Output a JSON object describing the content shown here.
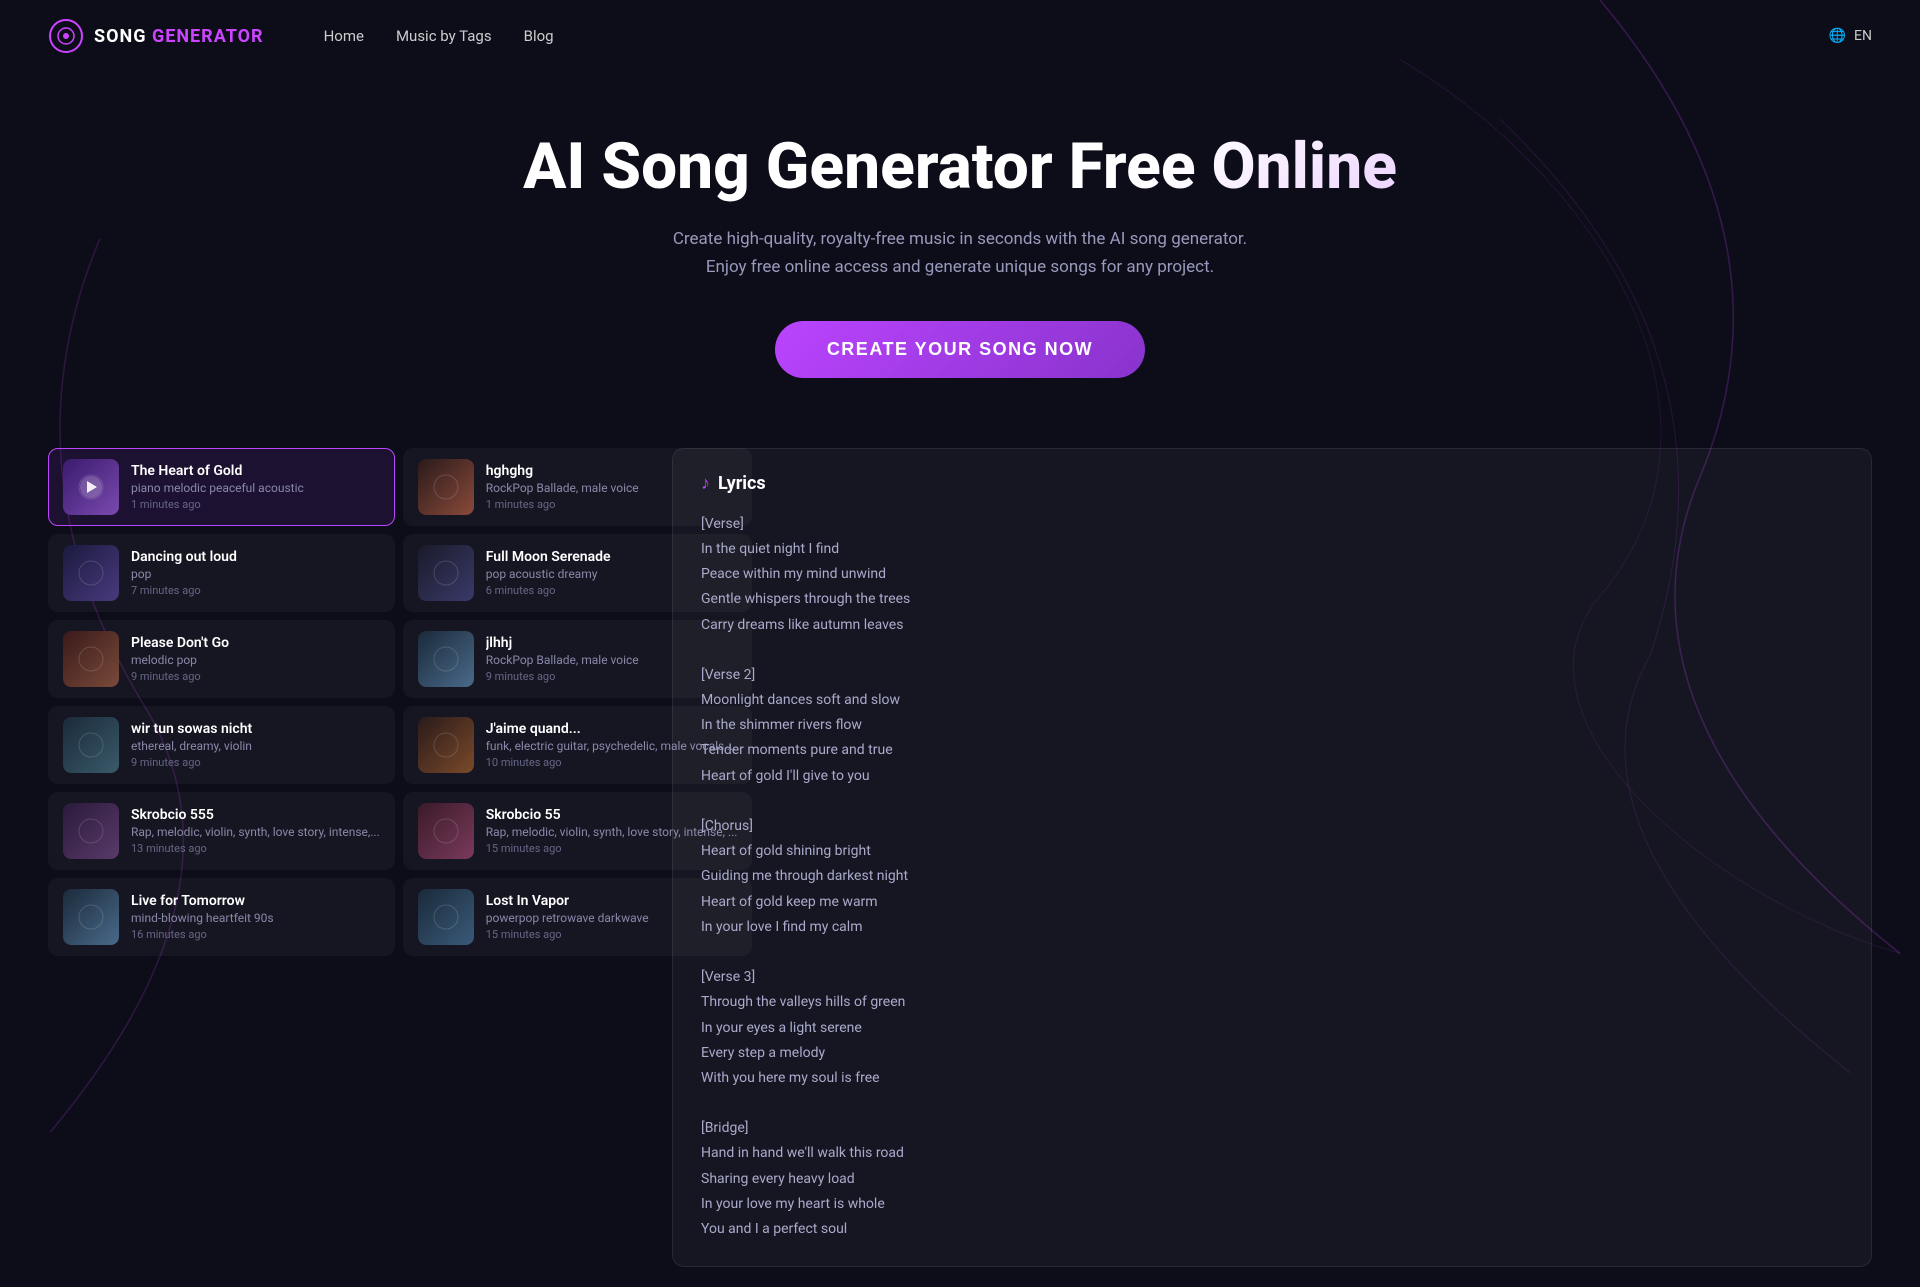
{
  "app": {
    "title": "AI Song Generator Free Online",
    "subtitle": "Create high-quality, royalty-free music in seconds with the AI song generator. Enjoy free online access and generate unique songs for any project.",
    "cta": "CREATE YOUR SONG NOW",
    "lang": "EN"
  },
  "logo": {
    "text_white": "SONG",
    "text_purple": "GENERATOR"
  },
  "nav": {
    "links": [
      {
        "label": "Home",
        "href": "#"
      },
      {
        "label": "Music by Tags",
        "href": "#"
      },
      {
        "label": "Blog",
        "href": "#"
      }
    ]
  },
  "songs_left": [
    {
      "id": 1,
      "title": "The Heart of Gold",
      "genre": "piano melodic peaceful acoustic",
      "time": "1 minutes ago",
      "active": true,
      "color_from": "#3a1a6e",
      "color_to": "#7a4aae"
    },
    {
      "id": 2,
      "title": "Dancing out loud",
      "genre": "pop",
      "time": "7 minutes ago",
      "active": false,
      "color_from": "#1a1a3e",
      "color_to": "#4a3a7e"
    },
    {
      "id": 3,
      "title": "Please Don't Go",
      "genre": "melodic pop",
      "time": "9 minutes ago",
      "active": false,
      "color_from": "#3a1a1a",
      "color_to": "#7a4a3a"
    },
    {
      "id": 4,
      "title": "wir tun sowas nicht",
      "genre": "ethereal, dreamy, violin",
      "time": "9 minutes ago",
      "active": false,
      "color_from": "#1a2a3a",
      "color_to": "#3a5a6a"
    },
    {
      "id": 5,
      "title": "Skrobcio 555",
      "genre": "Rap, melodic, violin, synth, love story, intense,...",
      "time": "13 minutes ago",
      "active": false,
      "color_from": "#2a1a3a",
      "color_to": "#5a3a6a"
    },
    {
      "id": 6,
      "title": "Live for Tomorrow",
      "genre": "mind-blowing heartfeit 90s",
      "time": "16 minutes ago",
      "active": false,
      "color_from": "#1a2a3a",
      "color_to": "#4a6a8a"
    }
  ],
  "songs_right": [
    {
      "id": 7,
      "title": "hghghg",
      "genre": "RockPop Ballade, male voice",
      "time": "1 minutes ago",
      "active": false,
      "color_from": "#2a1a1a",
      "color_to": "#8a4a3a"
    },
    {
      "id": 8,
      "title": "Full Moon Serenade",
      "genre": "pop acoustic dreamy",
      "time": "6 minutes ago",
      "active": false,
      "color_from": "#1a1a2a",
      "color_to": "#3a3a6a"
    },
    {
      "id": 9,
      "title": "jlhhj",
      "genre": "RockPop Ballade, male voice",
      "time": "9 minutes ago",
      "active": false,
      "color_from": "#1a2a3a",
      "color_to": "#4a6a8a"
    },
    {
      "id": 10,
      "title": "J'aime quand...",
      "genre": "funk, electric guitar, psychedelic, male vocals,...",
      "time": "10 minutes ago",
      "active": false,
      "color_from": "#2a1a1a",
      "color_to": "#7a4a2a"
    },
    {
      "id": 11,
      "title": "Skrobcio 55",
      "genre": "Rap, melodic, violin, synth, love story, intense, ...",
      "time": "15 minutes ago",
      "active": false,
      "color_from": "#3a1a2a",
      "color_to": "#7a3a5a"
    },
    {
      "id": 12,
      "title": "Lost In Vapor",
      "genre": "powerpop retrowave darkwave",
      "time": "15 minutes ago",
      "active": false,
      "color_from": "#1a2a3a",
      "color_to": "#3a5a7a"
    }
  ],
  "lyrics": {
    "title": "Lyrics",
    "content": "[Verse]\nIn the quiet night I find\nPeace within my mind unwind\nGentle whispers through the trees\nCarry dreams like autumn leaves\n\n[Verse 2]\nMoonlight dances soft and slow\nIn the shimmer rivers flow\nTender moments pure and true\nHeart of gold I'll give to you\n\n[Chorus]\nHeart of gold shining bright\nGuiding me through darkest night\nHeart of gold keep me warm\nIn your love I find my calm\n\n[Verse 3]\nThrough the valleys hills of green\nIn your eyes a light serene\nEvery step a melody\nWith you here my soul is free\n\n[Bridge]\nHand in hand we'll walk this road\nSharing every heavy load\nIn your love my heart is whole\nYou and I a perfect soul"
  }
}
